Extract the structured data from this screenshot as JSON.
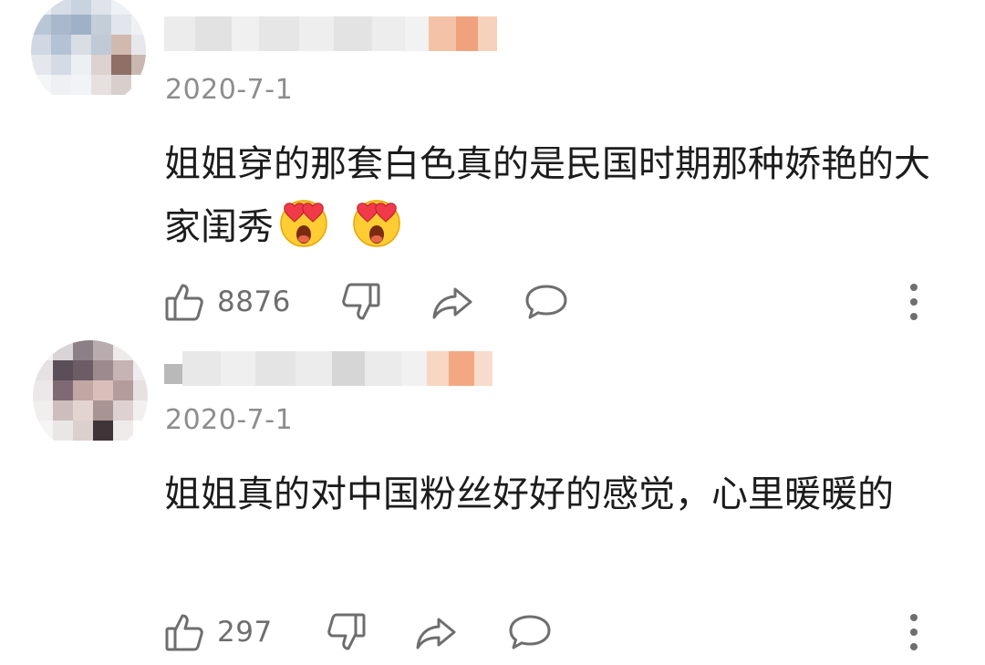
{
  "comments": [
    {
      "date": "2020-7-1",
      "text": "姐姐穿的那套白色真的是民国时期那种娇艳的大家闺秀",
      "emoji": [
        "heart-eyes-emoji",
        "heart-eyes-emoji"
      ],
      "likes": "8876"
    },
    {
      "date": "2020-7-1",
      "text": "姐姐真的对中国粉丝好好的感觉，心里暖暖的",
      "emoji": [],
      "likes": "297"
    }
  ],
  "icons": {
    "like": "thumbs-up-icon",
    "dislike": "thumbs-down-icon",
    "share": "share-icon",
    "reply": "comment-icon",
    "more": "more-vertical-icon"
  },
  "colors": {
    "text": "#1c1c1c",
    "meta": "#8d8d8d",
    "icon": "#6e6e6e",
    "badge": "#f3b08e"
  }
}
